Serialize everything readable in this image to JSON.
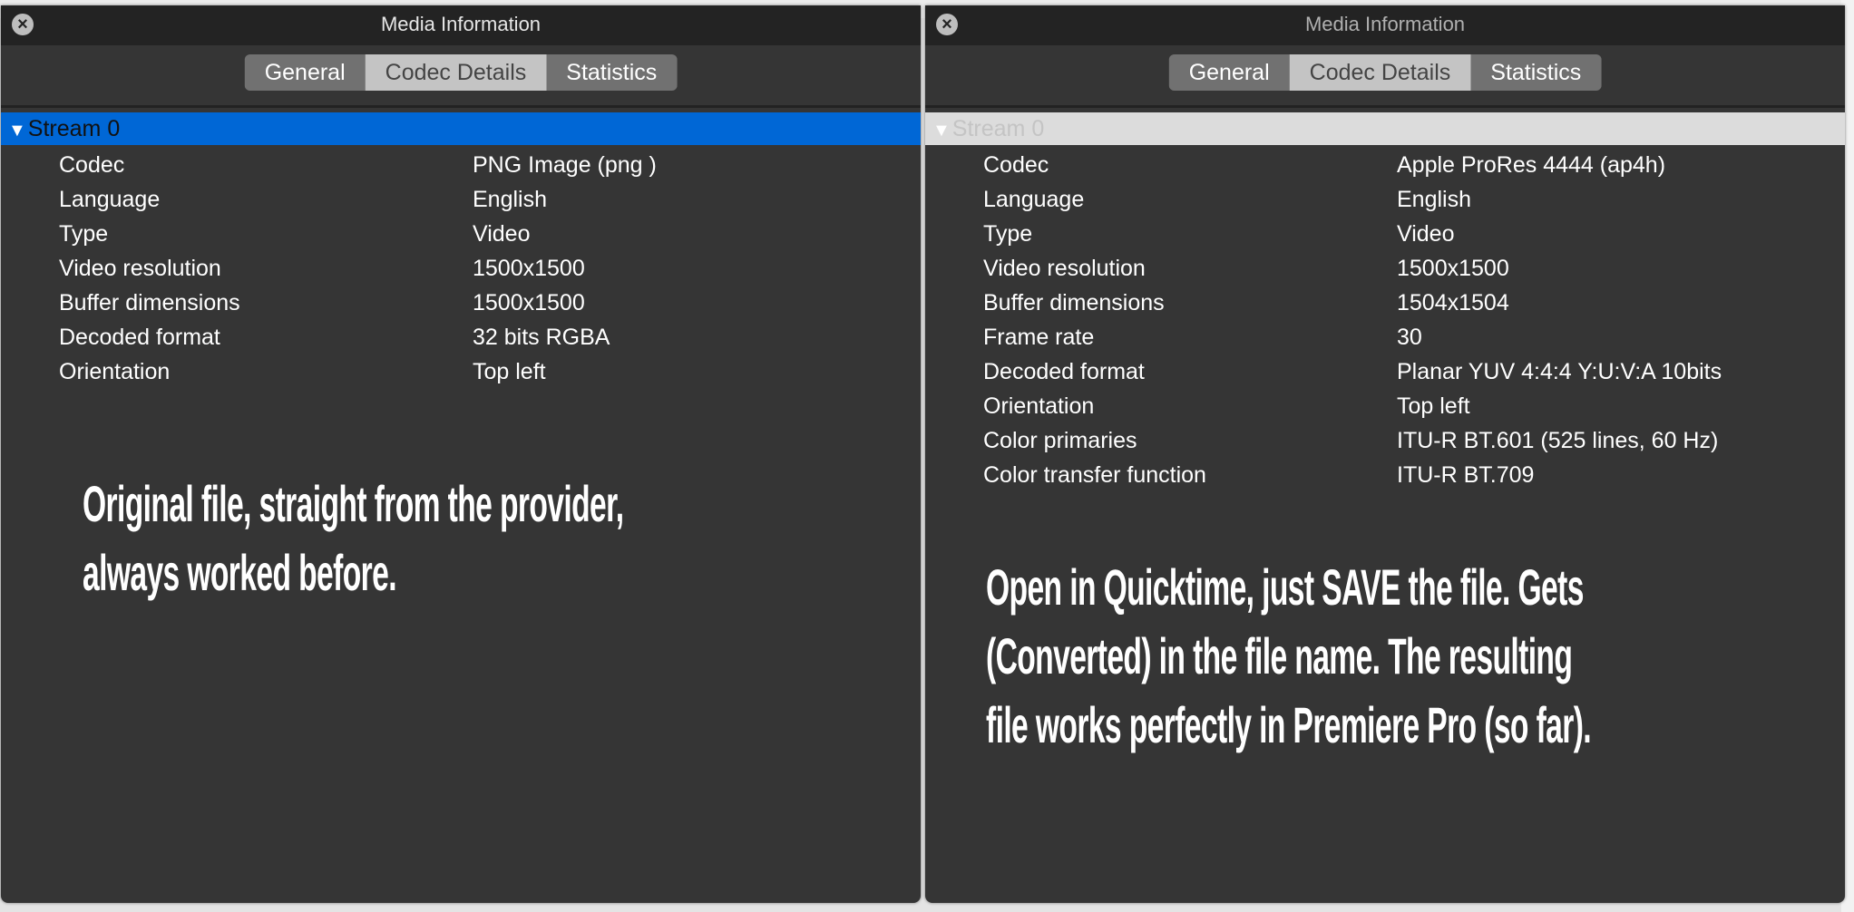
{
  "windows": [
    {
      "title": "Media Information",
      "tabs": [
        "General",
        "Codec Details",
        "Statistics"
      ],
      "selected_tab": "Codec Details",
      "stream": "Stream 0",
      "stream_selected": true,
      "rows": [
        {
          "label": "Codec",
          "value": "PNG Image (png )"
        },
        {
          "label": "Language",
          "value": "English"
        },
        {
          "label": "Type",
          "value": "Video"
        },
        {
          "label": "Video resolution",
          "value": "1500x1500"
        },
        {
          "label": "Buffer dimensions",
          "value": "1500x1500"
        },
        {
          "label": "Decoded format",
          "value": "32 bits RGBA"
        },
        {
          "label": "Orientation",
          "value": "Top left"
        }
      ],
      "annotation": [
        "Original file, straight from the provider,",
        "always worked before."
      ]
    },
    {
      "title": "Media Information",
      "tabs": [
        "General",
        "Codec Details",
        "Statistics"
      ],
      "selected_tab": "Codec Details",
      "stream": "Stream 0",
      "stream_selected": false,
      "rows": [
        {
          "label": "Codec",
          "value": "Apple ProRes 4444 (ap4h)"
        },
        {
          "label": "Language",
          "value": "English"
        },
        {
          "label": "Type",
          "value": "Video"
        },
        {
          "label": "Video resolution",
          "value": "1500x1500"
        },
        {
          "label": "Buffer dimensions",
          "value": "1504x1504"
        },
        {
          "label": "Frame rate",
          "value": "30"
        },
        {
          "label": "Decoded format",
          "value": "Planar YUV 4:4:4 Y:U:V:A 10bits"
        },
        {
          "label": "Orientation",
          "value": "Top left"
        },
        {
          "label": "Color primaries",
          "value": "ITU-R BT.601 (525 lines, 60 Hz)"
        },
        {
          "label": "Color transfer function",
          "value": "ITU-R BT.709"
        }
      ],
      "annotation": [
        "Open in Quicktime, just SAVE the file. Gets",
        "(Converted) in the file name. The resulting",
        "file works perfectly in Premiere Pro (so far)."
      ]
    }
  ],
  "colors": {
    "selection": "#0067d6",
    "panel": "#353535",
    "titlebar": "#232323"
  },
  "icons": {
    "close": "close-icon",
    "disclosure": "disclosure-triangle-icon"
  }
}
